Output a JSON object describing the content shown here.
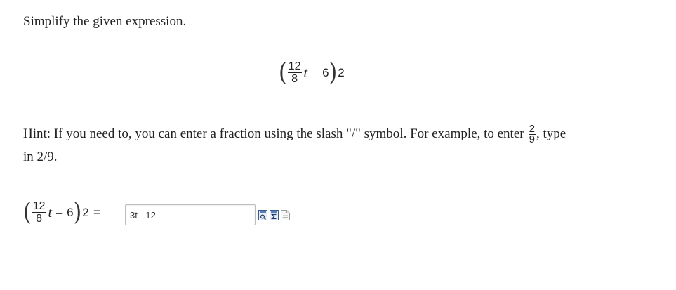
{
  "prompt": "Simplify the given expression.",
  "expression": {
    "open_paren": "(",
    "numerator": "12",
    "denominator": "8",
    "variable": "t",
    "minus": "–",
    "constant": "6",
    "close_paren": ")",
    "exponent": "2"
  },
  "hint": {
    "line1_text": "Hint: If you need to, you can enter a fraction using the slash \"/\" symbol. For example, to enter",
    "example_numerator": "2",
    "example_denominator": "9",
    "comma": ",",
    "line1_end": " type",
    "line2": "in 2/9."
  },
  "answer": {
    "equals": "=",
    "input_value": "3t - 12"
  },
  "tools": [
    {
      "icon": "preview-icon"
    },
    {
      "icon": "equation-editor-icon"
    },
    {
      "icon": "help-document-icon"
    }
  ]
}
